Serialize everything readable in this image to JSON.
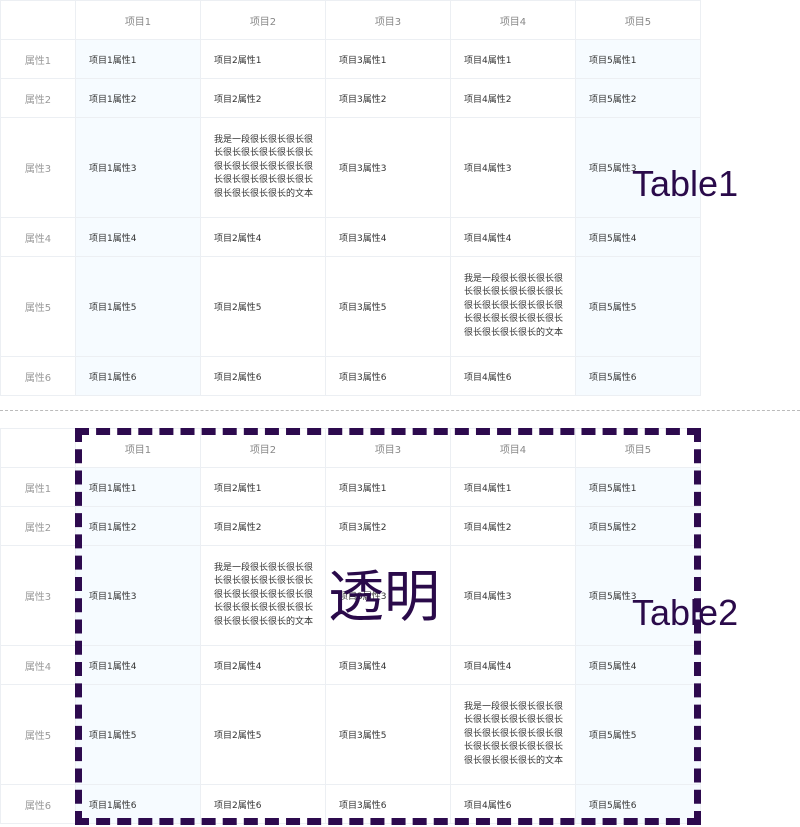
{
  "headers": [
    "",
    "项目1",
    "项目2",
    "项目3",
    "项目4",
    "项目5"
  ],
  "long_text": "我是一段很长很长很长很长很长很长很长很长很长很长很长很长很长很长很长很长很长很长很长很长很长很长很长很长的文本",
  "rows": [
    {
      "label": "属性1",
      "cells": [
        "项目1属性1",
        "项目2属性1",
        "项目3属性1",
        "项目4属性1",
        "项目5属性1"
      ]
    },
    {
      "label": "属性2",
      "cells": [
        "项目1属性2",
        "项目2属性2",
        "项目3属性2",
        "项目4属性2",
        "项目5属性2"
      ]
    },
    {
      "label": "属性3",
      "cells": [
        "项目1属性3",
        "LONG",
        "项目3属性3",
        "项目4属性3",
        "项目5属性3"
      ]
    },
    {
      "label": "属性4",
      "cells": [
        "项目1属性4",
        "项目2属性4",
        "项目3属性4",
        "项目4属性4",
        "项目5属性4"
      ]
    },
    {
      "label": "属性5",
      "cells": [
        "项目1属性5",
        "项目2属性5",
        "项目3属性5",
        "LONG",
        "项目5属性5"
      ]
    },
    {
      "label": "属性6",
      "cells": [
        "项目1属性6",
        "项目2属性6",
        "项目3属性6",
        "项目4属性6",
        "项目5属性6"
      ]
    }
  ],
  "labels": {
    "table1": "Table1",
    "table2": "Table2",
    "transparent": "透明"
  },
  "colors": {
    "accent": "#2d0a4e",
    "fixed_col_bg": "#f6fbff"
  }
}
